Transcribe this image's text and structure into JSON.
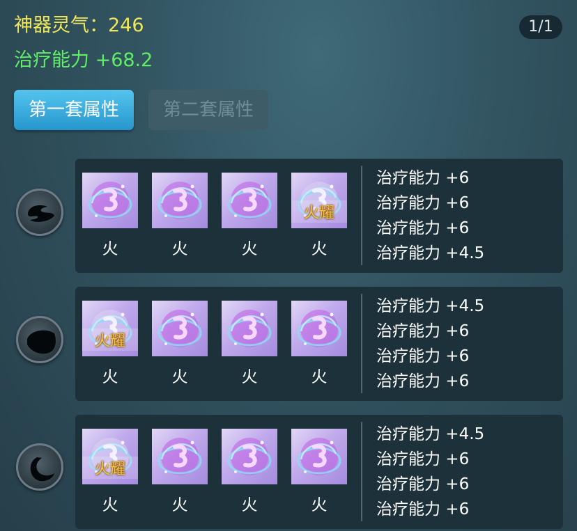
{
  "header": {
    "spirit_text": "神器灵气：246",
    "heal_text": "治疗能力 +68.2",
    "page_indicator": "1/1"
  },
  "tabs": [
    {
      "label": "第一套属性",
      "active": true
    },
    {
      "label": "第二套属性",
      "active": false
    }
  ],
  "colors": {
    "spirit_text": "#f0e65c",
    "heal_text": "#5fee66",
    "tab_active": "#2796cd",
    "tab_inactive_text": "#6f8c97",
    "awaken_tag": "#f4c542"
  },
  "rows": [
    {
      "icon": "swirl-rune-icon",
      "slots": [
        {
          "label": "火",
          "awaken": ""
        },
        {
          "label": "火",
          "awaken": ""
        },
        {
          "label": "火",
          "awaken": ""
        },
        {
          "label": "火",
          "awaken": "火耀"
        }
      ],
      "attributes": [
        "治疗能力 +6",
        "治疗能力 +6",
        "治疗能力 +6",
        "治疗能力 +4.5"
      ]
    },
    {
      "icon": "blob-rune-icon",
      "slots": [
        {
          "label": "火",
          "awaken": "火耀"
        },
        {
          "label": "火",
          "awaken": ""
        },
        {
          "label": "火",
          "awaken": ""
        },
        {
          "label": "火",
          "awaken": ""
        }
      ],
      "attributes": [
        "治疗能力 +4.5",
        "治疗能力 +6",
        "治疗能力 +6",
        "治疗能力 +6"
      ]
    },
    {
      "icon": "crescent-rune-icon",
      "slots": [
        {
          "label": "火",
          "awaken": "火耀"
        },
        {
          "label": "火",
          "awaken": ""
        },
        {
          "label": "火",
          "awaken": ""
        },
        {
          "label": "火",
          "awaken": ""
        }
      ],
      "attributes": [
        "治疗能力 +4.5",
        "治疗能力 +6",
        "治疗能力 +6",
        "治疗能力 +6"
      ]
    }
  ]
}
